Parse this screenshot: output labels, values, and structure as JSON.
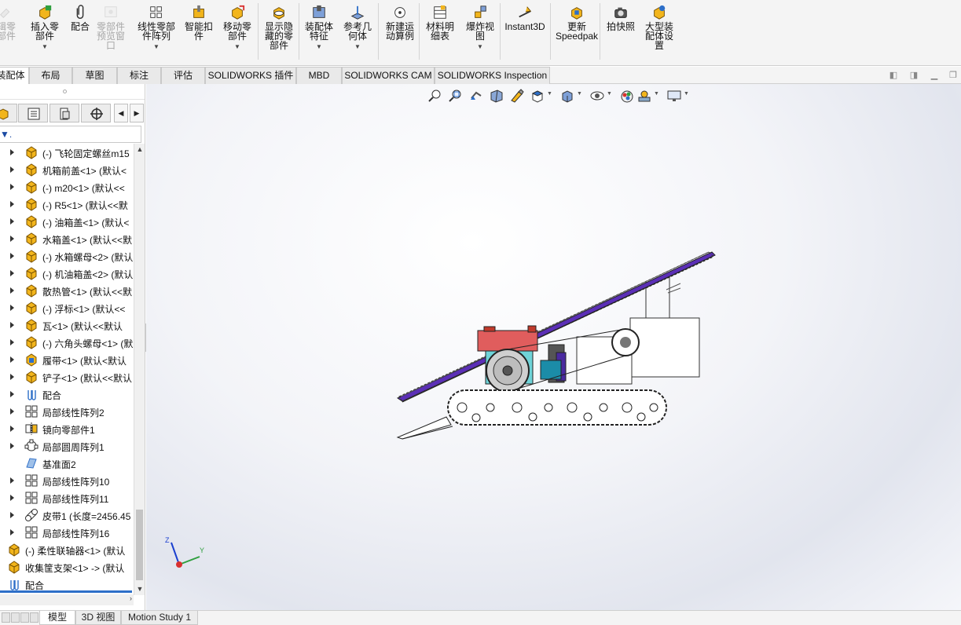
{
  "ribbon": {
    "buttons": [
      {
        "name": "edit-component-button",
        "label": "辑零\n部件",
        "icon": "edit-component-icon",
        "disabled": true,
        "dropdown": false
      },
      {
        "name": "insert-component-button",
        "label": "插入零\n部件",
        "icon": "insert-component-icon",
        "disabled": false,
        "dropdown": true
      },
      {
        "name": "mate-button",
        "label": "配合",
        "icon": "paperclip-icon",
        "disabled": false,
        "dropdown": false
      },
      {
        "name": "component-preview-button",
        "label": "零部件\n预览窗\n口",
        "icon": "preview-window-icon",
        "disabled": true,
        "dropdown": false
      },
      {
        "name": "linear-pattern-button",
        "label": "线性零部\n件阵列",
        "icon": "linear-pattern-icon",
        "disabled": false,
        "dropdown": true
      },
      {
        "name": "smart-fasteners-button",
        "label": "智能扣\n件",
        "icon": "smart-fastener-icon",
        "disabled": false,
        "dropdown": false
      },
      {
        "name": "move-component-button",
        "label": "移动零\n部件",
        "icon": "move-component-icon",
        "disabled": false,
        "dropdown": true
      },
      {
        "name": "show-hidden-button",
        "label": "显示隐\n藏的零\n部件",
        "icon": "show-hidden-icon",
        "disabled": false,
        "dropdown": false
      },
      {
        "name": "assembly-features-button",
        "label": "装配体\n特征",
        "icon": "assembly-feature-icon",
        "disabled": false,
        "dropdown": true
      },
      {
        "name": "reference-geometry-button",
        "label": "参考几\n何体",
        "icon": "reference-geometry-icon",
        "disabled": false,
        "dropdown": true
      },
      {
        "name": "new-motion-study-button",
        "label": "新建运\n动算例",
        "icon": "motion-study-icon",
        "disabled": false,
        "dropdown": false
      },
      {
        "name": "bill-of-materials-button",
        "label": "材料明\n细表",
        "icon": "bom-icon",
        "disabled": false,
        "dropdown": false
      },
      {
        "name": "exploded-view-button",
        "label": "爆炸视\n图",
        "icon": "exploded-view-icon",
        "disabled": false,
        "dropdown": true
      },
      {
        "name": "instant3d-button",
        "label": "Instant3D",
        "icon": "instant3d-icon",
        "disabled": false,
        "dropdown": false
      },
      {
        "name": "update-speedpak-button",
        "label": "更新\nSpeedpak",
        "icon": "speedpak-icon",
        "disabled": false,
        "dropdown": false
      },
      {
        "name": "take-snapshot-button",
        "label": "拍快照",
        "icon": "camera-icon",
        "disabled": false,
        "dropdown": false
      },
      {
        "name": "large-assembly-button",
        "label": "大型装\n配体设\n置",
        "icon": "large-assembly-icon",
        "disabled": false,
        "dropdown": false
      }
    ]
  },
  "tabs": [
    "装配体",
    "布局",
    "草图",
    "标注",
    "评估",
    "SOLIDWORKS 插件",
    "MBD",
    "SOLIDWORKS CAM",
    "SOLIDWORKS Inspection"
  ],
  "tree": {
    "items": [
      {
        "label": "(-) 飞轮固定螺丝m15",
        "icon": "part-icon",
        "level": 1
      },
      {
        "label": "机箱前盖<1> (默认<",
        "icon": "part-icon",
        "level": 1
      },
      {
        "label": "(-) m20<1> (默认<<",
        "icon": "part-icon",
        "level": 1
      },
      {
        "label": "(-) R5<1> (默认<<默",
        "icon": "part-icon",
        "level": 1
      },
      {
        "label": "(-) 油箱盖<1> (默认<",
        "icon": "part-icon",
        "level": 1
      },
      {
        "label": "水箱盖<1> (默认<<默",
        "icon": "part-icon",
        "level": 1
      },
      {
        "label": "(-) 水箱螺母<2> (默认",
        "icon": "part-icon",
        "level": 1
      },
      {
        "label": "(-) 机油箱盖<2> (默认",
        "icon": "part-icon",
        "level": 1
      },
      {
        "label": "散热管<1> (默认<<默",
        "icon": "part-icon",
        "level": 1
      },
      {
        "label": "(-) 浮标<1> (默认<<",
        "icon": "part-icon",
        "level": 1
      },
      {
        "label": "瓦<1> (默认<<默认",
        "icon": "part-icon",
        "level": 1
      },
      {
        "label": "(-) 六角头螺母<1> (默",
        "icon": "part-icon",
        "level": 1
      },
      {
        "label": "履带<1> (默认<默认",
        "icon": "subassembly-icon",
        "level": 1
      },
      {
        "label": "铲子<1> (默认<<默认",
        "icon": "part-icon",
        "level": 1
      },
      {
        "label": "配合",
        "icon": "mates-icon",
        "level": 1
      },
      {
        "label": "局部线性阵列2",
        "icon": "linear-pattern-icon",
        "level": 1
      },
      {
        "label": "镜向零部件1",
        "icon": "mirror-component-icon",
        "level": 1
      },
      {
        "label": "局部圆周阵列1",
        "icon": "circular-pattern-icon",
        "level": 1
      },
      {
        "label": "基准面2",
        "icon": "plane-icon",
        "level": 1
      },
      {
        "label": "局部线性阵列10",
        "icon": "linear-pattern-icon",
        "level": 1
      },
      {
        "label": "局部线性阵列11",
        "icon": "linear-pattern-icon",
        "level": 1
      },
      {
        "label": "皮带1 (长度=2456.45",
        "icon": "belt-icon",
        "level": 1
      },
      {
        "label": "局部线性阵列16",
        "icon": "linear-pattern-icon",
        "level": 1
      },
      {
        "label": "(-) 柔性联轴器<1> (默认",
        "icon": "part-icon",
        "level": 0
      },
      {
        "label": "收集筐支架<1> -> (默认",
        "icon": "part-icon",
        "level": 0
      },
      {
        "label": "配合",
        "icon": "mates-icon",
        "level": 0
      }
    ]
  },
  "bottom_tabs": [
    "模型",
    "3D 视图",
    "Motion Study 1"
  ],
  "triad": {
    "z": "Z",
    "y": "Y"
  },
  "colors": {
    "accent": "#2e6fc8",
    "part_yellow": "#f2b51c",
    "belt_purple": "#5b2fb6",
    "engine_red": "#e05d5d",
    "engine_cyan": "#6fd3d8"
  }
}
